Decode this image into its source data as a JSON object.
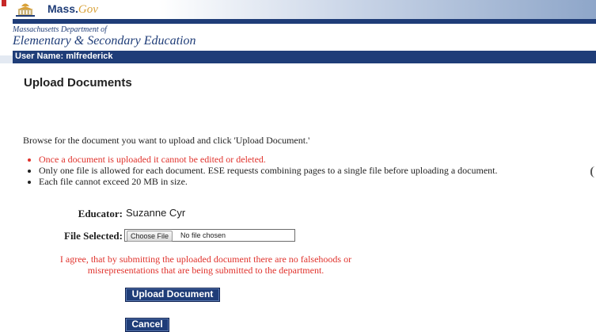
{
  "header": {
    "brand_main": "Mass.",
    "brand_suffix": "Gov",
    "dept_line1": "Massachusetts Department of",
    "dept_line2": "Elementary & Secondary Education",
    "user_label": "User Name: mlfrederick"
  },
  "page": {
    "title": "Upload Documents",
    "instructions": "Browse for the document you want to upload and click 'Upload Document.'",
    "notes": [
      "Once a document is uploaded it cannot be edited or deleted.",
      "Only one file is allowed for each document. ESE requests combining pages to a single file before uploading a document.",
      "Each file cannot exceed 20 MB in size."
    ]
  },
  "form": {
    "educator_label": "Educator:",
    "educator_value": "Suzanne Cyr",
    "file_label": "File Selected:",
    "choose_button": "Choose File",
    "no_file_text": "No file chosen",
    "agreement": "I agree, that by submitting the uploaded document there are no falsehoods or misrepresentations that are being submitted to the department.",
    "upload_button": "Upload Document",
    "cancel_button": "Cancel"
  },
  "colors": {
    "navy": "#1f3d78",
    "warning_red": "#e0322c",
    "gold": "#d9a23a"
  }
}
